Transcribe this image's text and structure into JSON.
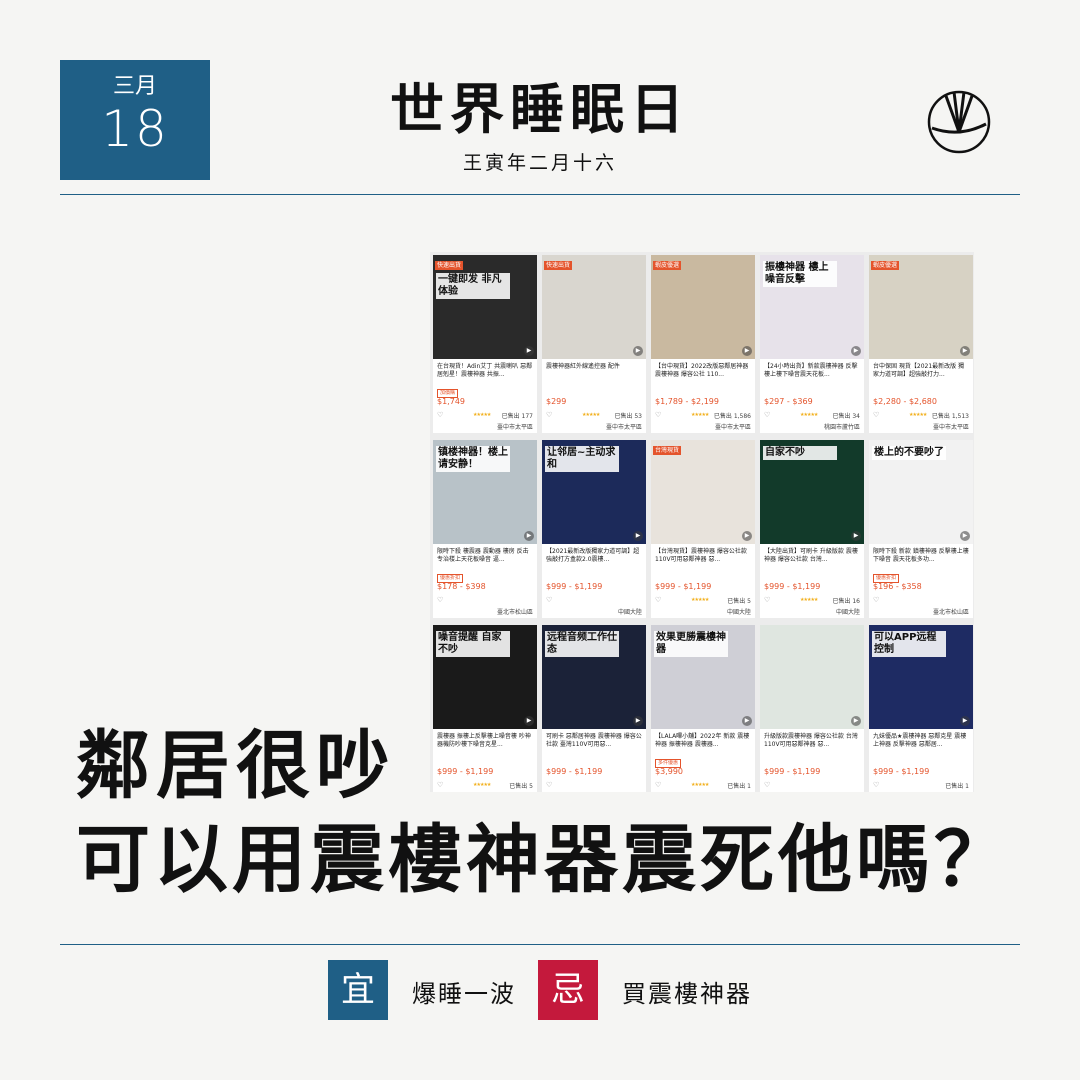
{
  "date": {
    "month": "三月",
    "day": "18"
  },
  "header": {
    "title": "世界睡眠日",
    "subtitle": "王寅年二月十六"
  },
  "headline": {
    "line1": "鄰居很吵",
    "line2": "可以用震樓神器震死他嗎？"
  },
  "footer": {
    "yi_label": "宜",
    "yi_text": "爆睡一波",
    "ji_label": "忌",
    "ji_text": "買震樓神器"
  },
  "colors": {
    "brand_blue": "#1f5f86",
    "brand_red": "#c4193c",
    "price_orange": "#e4542c"
  },
  "products": [
    {
      "title": "在台現貨！Adin艾丁 共震喇叭 惡鄰居剋星！震樓神器 共振...",
      "tag": "加價購",
      "price": "$1,749",
      "sold": "已售出 177",
      "stars": "★★★★★",
      "location": "臺中市太平區",
      "overlay": "一键即发 非凡体验",
      "badge": "快速出貨"
    },
    {
      "title": "震樓神器紅外線遙控器 配件",
      "tag": "",
      "price": "$299",
      "sold": "已售出 53",
      "stars": "★★★★★",
      "location": "臺中市太平區",
      "overlay": "",
      "badge": "快速出貨"
    },
    {
      "title": "【台中現貨】2022改版惡鄰居神器 震樓神器 爆容公社 110...",
      "tag": "",
      "price": "$1,789 - $2,199",
      "sold": "已售出 1,586",
      "stars": "★★★★★",
      "location": "臺中市太平區",
      "overlay": "",
      "badge": "蝦皮優選"
    },
    {
      "title": "【24小時出貨】新款震樓神器 反擊樓上樓下噪音震天花板...",
      "tag": "",
      "price": "$297 - $369",
      "sold": "已售出 34",
      "stars": "★★★★★",
      "location": "桃園市蘆竹區",
      "overlay": "振樓神器 樓上噪音反擊",
      "badge": ""
    },
    {
      "title": "台中保固 現貨【2021最新改版 獨家力道可調】超強敲打力...",
      "tag": "",
      "price": "$2,280 - $2,680",
      "sold": "已售出 1,513",
      "stars": "★★★★★",
      "location": "臺中市太平區",
      "overlay": "",
      "badge": "蝦皮優選"
    },
    {
      "title": "限時下殺 樓震器 震動器 樓房 反击 专治楼上天花板噪音 逼...",
      "tag": "優惠折扣",
      "price": "$178 - $398",
      "sold": "",
      "stars": "",
      "location": "臺北市松山區",
      "overlay": "镇楼神器！楼上请安静！",
      "badge": ""
    },
    {
      "title": "【2021最新改版獨家力道可調】超強敲打方盒款2.0震樓...",
      "tag": "",
      "price": "$999 - $1,199",
      "sold": "",
      "stars": "",
      "location": "中國大陸",
      "overlay": "让邻居~主动求和",
      "badge": ""
    },
    {
      "title": "【台灣現貨】震樓神器 爆容公社款 110V可用惡鄰神器 惡...",
      "tag": "",
      "price": "$999 - $1,199",
      "sold": "已售出 5",
      "stars": "★★★★★",
      "location": "中國大陸",
      "overlay": "",
      "badge": "台灣現貨"
    },
    {
      "title": "【大陸出貨】可刷卡 升級版款 震樓神器 爆容公社款 台灣...",
      "tag": "",
      "price": "$999 - $1,199",
      "sold": "已售出 16",
      "stars": "★★★★★",
      "location": "中國大陸",
      "overlay": "自家不吵",
      "badge": ""
    },
    {
      "title": "限時下殺 新款 鎮樓神器 反擊樓上樓下噪音 震天花板多功...",
      "tag": "優惠折扣",
      "price": "$196 - $358",
      "sold": "",
      "stars": "",
      "location": "臺北市松山區",
      "overlay": "楼上的不要吵了",
      "badge": ""
    },
    {
      "title": "震樓器 振樓上反擊樓上噪音樓 吵神器機防吵樓下噪音克星...",
      "tag": "",
      "price": "$999 - $1,199",
      "sold": "已售出 5",
      "stars": "★★★★★",
      "location": "",
      "overlay": "噪音提醒 自家不吵",
      "badge": ""
    },
    {
      "title": "可刷卡 惡鄰居神器 震樓神器 爆容公社款 臺灣110V可用惡...",
      "tag": "",
      "price": "$999 - $1,199",
      "sold": "",
      "stars": "",
      "location": "",
      "overlay": "远程音频工作仕态",
      "badge": ""
    },
    {
      "title": "【LALA嗶小舖】2022年 新款 震樓神器 振樓神器 震樓器...",
      "tag": "多件優惠",
      "price": "$3,990",
      "sold": "已售出 1",
      "stars": "★★★★★",
      "location": "",
      "overlay": "效果更勝震樓神器",
      "badge": ""
    },
    {
      "title": "升級版款震樓神器 爆容公社款 台灣110V可用惡鄰神器 惡...",
      "tag": "",
      "price": "$999 - $1,199",
      "sold": "",
      "stars": "",
      "location": "",
      "overlay": "",
      "badge": ""
    },
    {
      "title": "九妹優品★震樓神器 惡鄰克星 震樓上神器 反擊神器 惡鄰居...",
      "tag": "",
      "price": "$999 - $1,199",
      "sold": "已售出 1",
      "stars": "",
      "location": "",
      "overlay": "可以APP远程控制",
      "badge": ""
    }
  ]
}
